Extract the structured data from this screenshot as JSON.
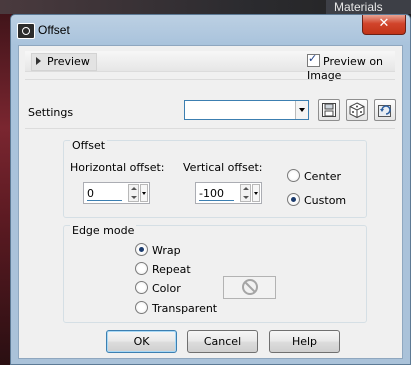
{
  "background": {
    "materials_label": "Materials"
  },
  "window": {
    "title": "Offset",
    "close_label": "✕"
  },
  "preview": {
    "toggle_label": "Preview",
    "preview_on_image_label": "Preview on Image",
    "preview_on_image_checked": true
  },
  "settings": {
    "label": "Settings",
    "value": ""
  },
  "offset_group": {
    "title": "Offset",
    "horizontal_label": "Horizontal offset:",
    "horizontal_value": "0",
    "vertical_label": "Vertical offset:",
    "vertical_value": "-100",
    "center_label": "Center",
    "custom_label": "Custom",
    "selected": "Custom"
  },
  "edge_group": {
    "title": "Edge mode",
    "options": [
      "Wrap",
      "Repeat",
      "Color",
      "Transparent"
    ],
    "selected": "Wrap"
  },
  "buttons": {
    "ok": "OK",
    "cancel": "Cancel",
    "help": "Help"
  },
  "icons": [
    "camera-icon",
    "save-preset-icon",
    "randomize-dice-icon",
    "reset-icon",
    "no-color-icon"
  ]
}
